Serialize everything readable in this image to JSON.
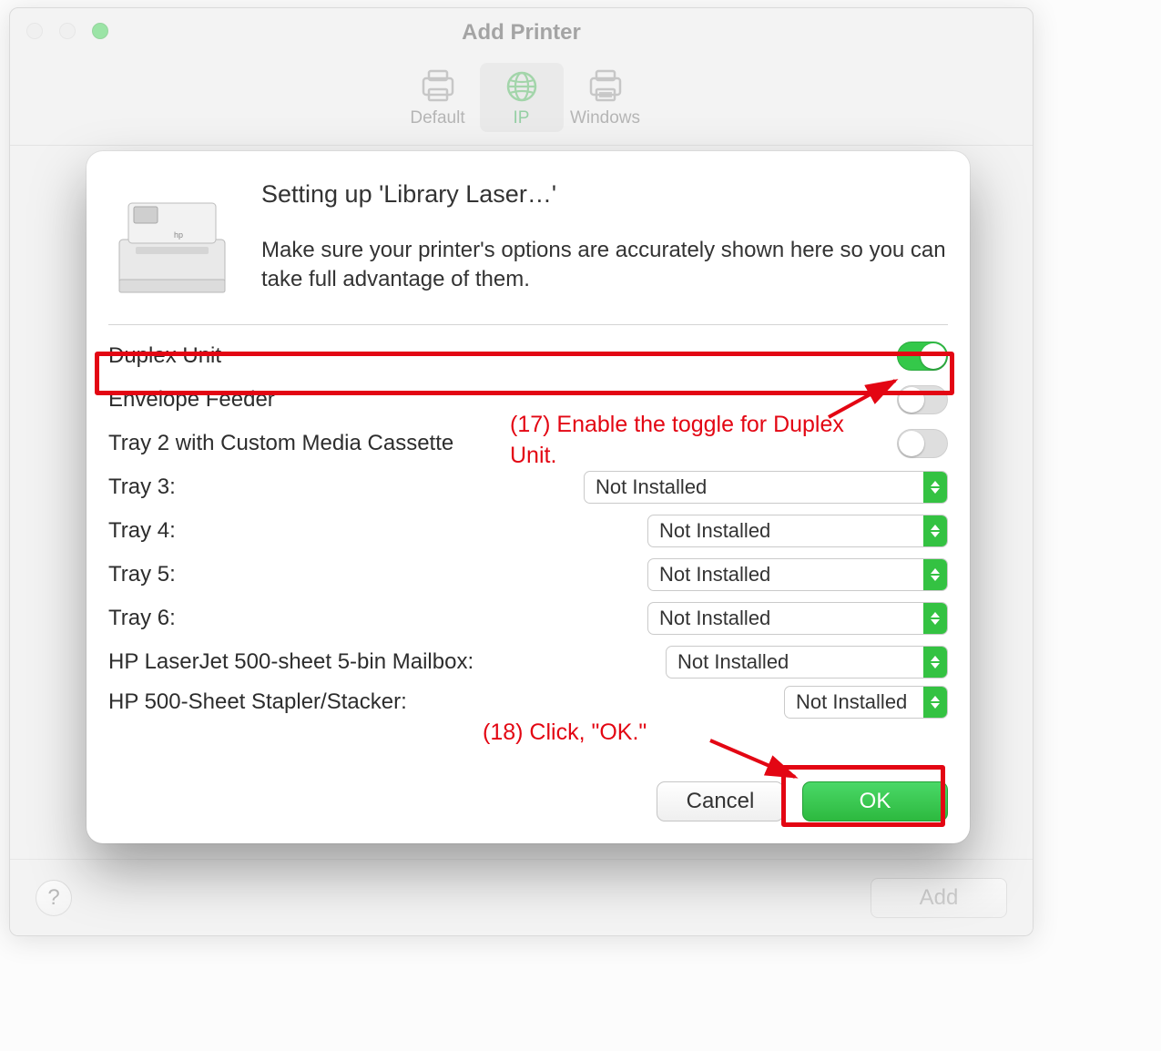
{
  "window": {
    "title": "Add Printer",
    "tabs": [
      {
        "label": "Default",
        "icon": "printer-icon",
        "selected": false
      },
      {
        "label": "IP",
        "icon": "globe-icon",
        "selected": true
      },
      {
        "label": "Windows",
        "icon": "printer-win-icon",
        "selected": false
      }
    ],
    "help_label": "?",
    "add_button": "Add"
  },
  "sheet": {
    "title": "Setting up 'Library Laser…'",
    "description": "Make sure your printer's options are accurately shown here so you can take full advantage of them.",
    "options": [
      {
        "type": "toggle",
        "label": "Duplex Unit",
        "on": true
      },
      {
        "type": "toggle",
        "label": "Envelope Feeder",
        "on": false
      },
      {
        "type": "toggle",
        "label": "Tray 2 with Custom Media Cassette",
        "on": false
      },
      {
        "type": "select",
        "label": "Tray 3:",
        "value": "Not Installed"
      },
      {
        "type": "select",
        "label": "Tray 4:",
        "value": "Not Installed"
      },
      {
        "type": "select",
        "label": "Tray 5:",
        "value": "Not Installed"
      },
      {
        "type": "select",
        "label": "Tray 6:",
        "value": "Not Installed"
      },
      {
        "type": "select",
        "label": "HP LaserJet 500-sheet 5-bin Mailbox:",
        "value": "Not Installed"
      },
      {
        "type": "select",
        "label": "HP 500-Sheet Stapler/Stacker:",
        "value": "Not Installed"
      }
    ],
    "cancel": "Cancel",
    "ok": "OK"
  },
  "annotations": {
    "a17": "(17) Enable the toggle for Duplex Unit.",
    "a18": "(18) Click, \"OK.\""
  }
}
